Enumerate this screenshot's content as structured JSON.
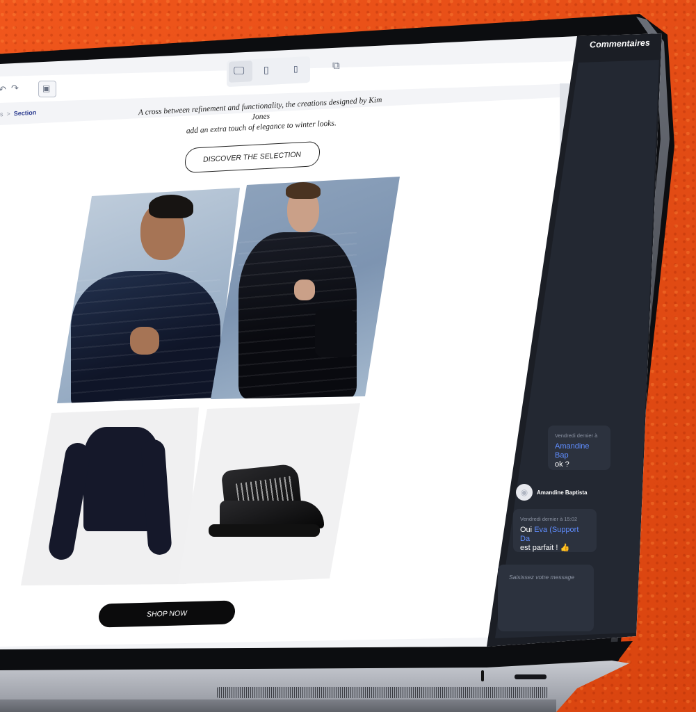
{
  "panel": {
    "title": "Commentaires",
    "messages": [
      {
        "time": "Vendredi dernier à",
        "mention": "Amandine Bap",
        "text": "ok ?"
      },
      {
        "time": "Vendredi dernier à 15:02",
        "prefix": "Oui ",
        "mention": "Eva (Support Da",
        "text": "est parfait ! 👍"
      }
    ],
    "author_name": "Amandine Baptista",
    "input_placeholder": "Saisissez votre message"
  },
  "breadcrumb": {
    "prev": "s",
    "separator": ">",
    "current": "Section"
  },
  "content": {
    "intro_line1": "A cross between refinement and functionality, the creations designed by Kim Jones",
    "intro_line2": "add an extra touch of elegance to winter looks.",
    "discover_button": "DISCOVER THE SELECTION",
    "shop_button": "SHOP NOW"
  },
  "toolbar": {
    "devices": [
      "desktop",
      "tablet",
      "mobile"
    ],
    "active_device": "desktop"
  },
  "colors": {
    "background": "#e8501e",
    "panel": "#1b1e25",
    "mention": "#5f8dff",
    "active_breadcrumb": "#2b3b8f"
  }
}
